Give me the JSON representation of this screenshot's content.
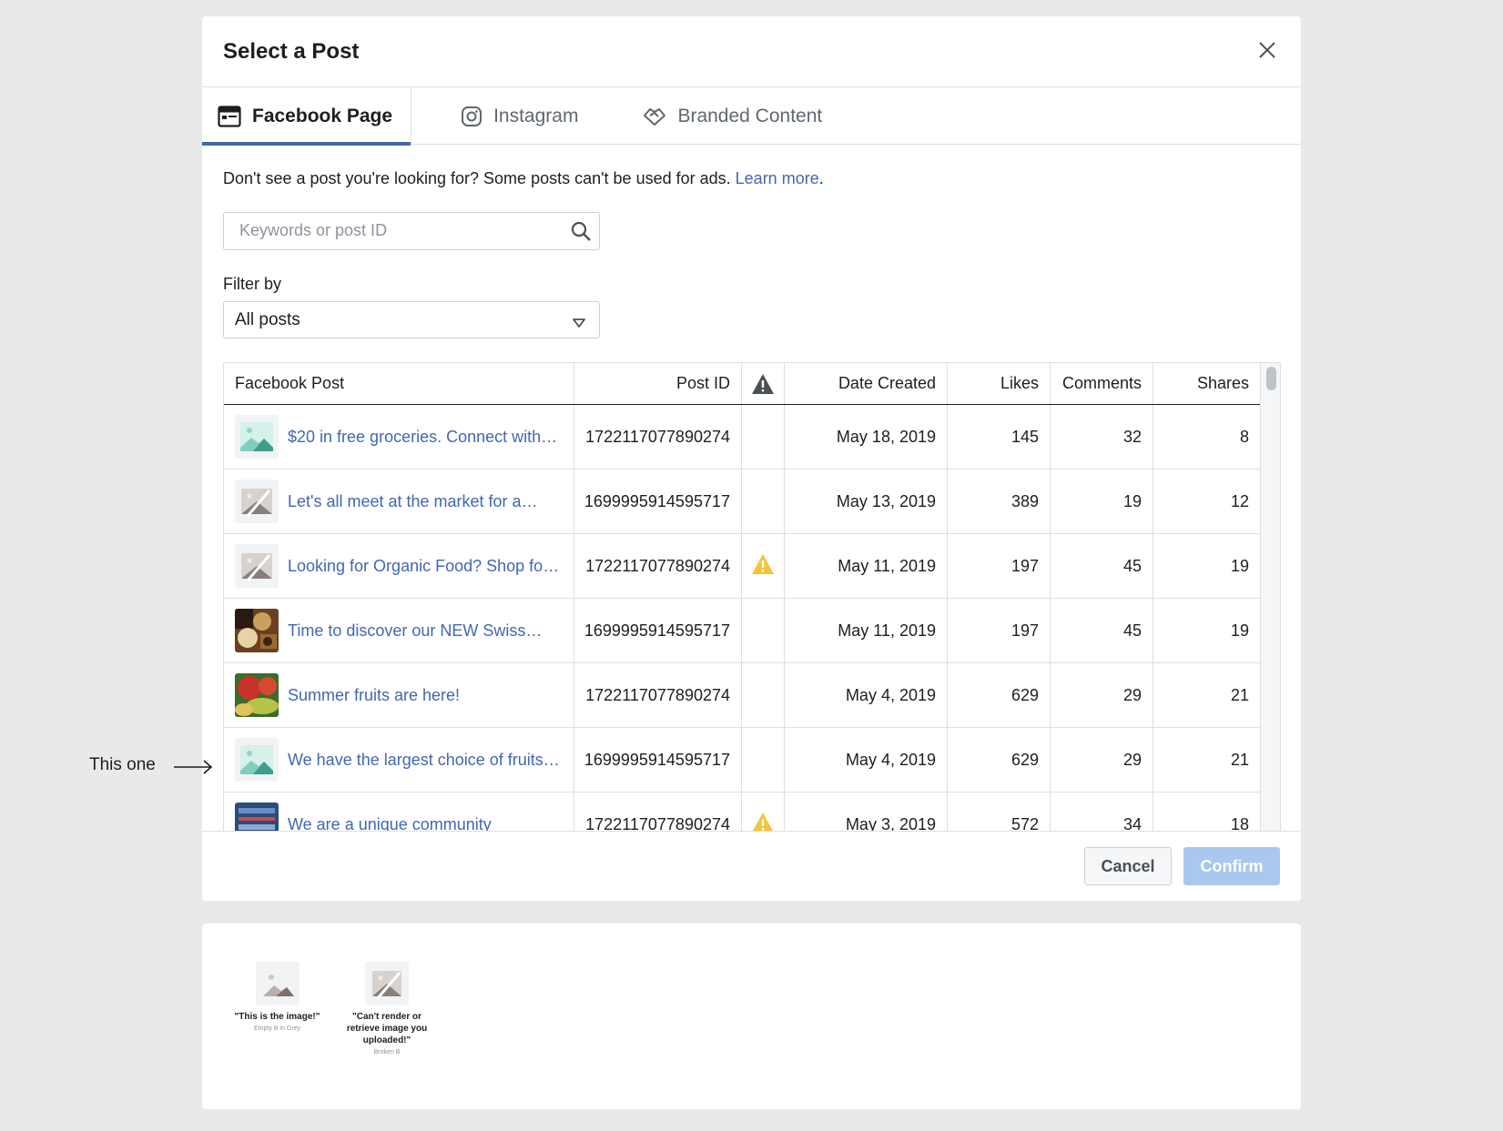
{
  "dialog": {
    "title": "Select a Post",
    "tabs": [
      {
        "label": "Facebook Page",
        "icon": "page-icon",
        "active": true
      },
      {
        "label": "Instagram",
        "icon": "instagram-icon",
        "active": false
      },
      {
        "label": "Branded Content",
        "icon": "handshake-icon",
        "active": false
      }
    ],
    "notice_text": "Don't see a post you're looking for? Some posts can't be used for ads.",
    "notice_link": "Learn more",
    "search_placeholder": "Keywords or post ID",
    "filter_label": "Filter by",
    "filter_value": "All posts"
  },
  "table": {
    "headers": {
      "post": "Facebook Post",
      "post_id": "Post ID",
      "warning": "warning-icon",
      "date": "Date Created",
      "likes": "Likes",
      "comments": "Comments",
      "shares": "Shares"
    },
    "rows": [
      {
        "thumb": "empty-teal",
        "text": "$20 in free groceries. Connect with…",
        "id": "1722117077890274",
        "warning": false,
        "date": "May 18, 2019",
        "likes": "145",
        "comments": "32",
        "shares": "8"
      },
      {
        "thumb": "broken",
        "text": "Let's all meet at the market for a…",
        "id": "1699995914595717",
        "warning": false,
        "date": "May 13, 2019",
        "likes": "389",
        "comments": "19",
        "shares": "12"
      },
      {
        "thumb": "broken",
        "text": "Looking for Organic Food? Shop for…",
        "id": "1722117077890274",
        "warning": true,
        "date": "May 11, 2019",
        "likes": "197",
        "comments": "45",
        "shares": "19"
      },
      {
        "thumb": "photo-cheese",
        "text": "Time to discover our NEW Swiss…",
        "id": "1699995914595717",
        "warning": false,
        "date": "May 11, 2019",
        "likes": "197",
        "comments": "45",
        "shares": "19"
      },
      {
        "thumb": "photo-fruits",
        "text": "Summer fruits are here!",
        "id": "1722117077890274",
        "warning": false,
        "date": "May 4, 2019",
        "likes": "629",
        "comments": "29",
        "shares": "21"
      },
      {
        "thumb": "empty-teal",
        "text": "We have the largest choice of fruits…",
        "id": "1699995914595717",
        "warning": false,
        "date": "May 4, 2019",
        "likes": "629",
        "comments": "29",
        "shares": "21"
      },
      {
        "thumb": "photo-community",
        "text": "We are a unique community",
        "id": "1722117077890274",
        "warning": true,
        "date": "May 3, 2019",
        "likes": "572",
        "comments": "34",
        "shares": "18"
      }
    ]
  },
  "footer": {
    "cancel": "Cancel",
    "confirm": "Confirm"
  },
  "annotation": {
    "text": "This one"
  },
  "legend": {
    "items": [
      {
        "title": "\"This is the image!\"",
        "sub": "Empty B in Grey"
      },
      {
        "title": "\"Can't render or retrieve image you uploaded!\"",
        "sub": "Broken B"
      }
    ]
  },
  "colors": {
    "accent": "#4267b2",
    "warning": "#f5c33b",
    "confirm_disabled": "#a8c8ef",
    "thumb_teal": "#7fcfc0"
  }
}
